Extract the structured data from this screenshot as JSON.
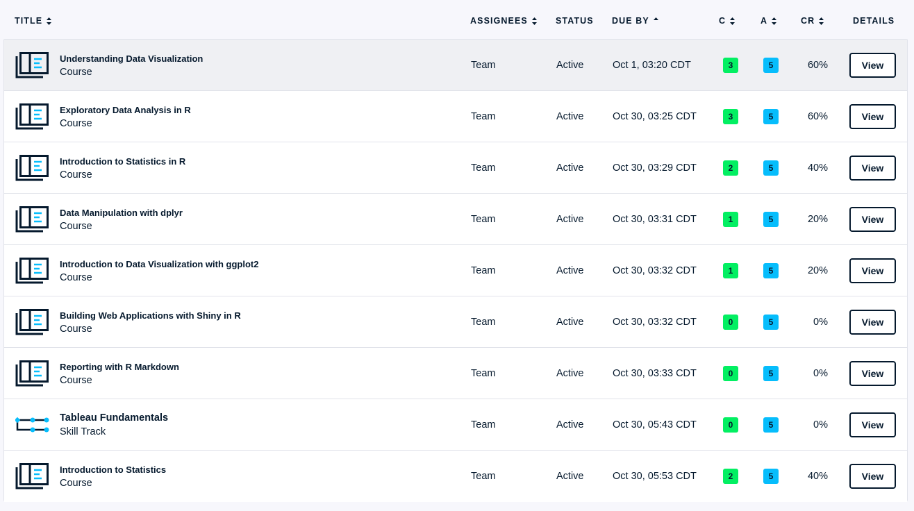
{
  "header": {
    "title": "TITLE",
    "assignees": "ASSIGNEES",
    "status": "STATUS",
    "due_by": "DUE BY",
    "c": "C",
    "a": "A",
    "cr": "CR",
    "details": "DETAILS"
  },
  "sort": {
    "active_column": "due_by",
    "direction": "ascending"
  },
  "colors": {
    "c_badge": "#03ef62",
    "a_badge": "#06bdfc",
    "row_highlight": "#eff0f3",
    "icon_accent": "#06bdfc",
    "ink": "#05192d"
  },
  "rows": [
    {
      "icon": "course-icon",
      "title": "Understanding Data Visualization",
      "type": "Course",
      "assignees": "Team",
      "status": "Active",
      "due": "Oct 1, 03:20 CDT",
      "c": "3",
      "a": "5",
      "cr": "60%",
      "action": "View"
    },
    {
      "icon": "course-icon",
      "title": "Exploratory Data Analysis in R",
      "type": "Course",
      "assignees": "Team",
      "status": "Active",
      "due": "Oct 30, 03:25 CDT",
      "c": "3",
      "a": "5",
      "cr": "60%",
      "action": "View"
    },
    {
      "icon": "course-icon",
      "title": "Introduction to Statistics in R",
      "type": "Course",
      "assignees": "Team",
      "status": "Active",
      "due": "Oct 30, 03:29 CDT",
      "c": "2",
      "a": "5",
      "cr": "40%",
      "action": "View"
    },
    {
      "icon": "course-icon",
      "title": "Data Manipulation with dplyr",
      "type": "Course",
      "assignees": "Team",
      "status": "Active",
      "due": "Oct 30, 03:31 CDT",
      "c": "1",
      "a": "5",
      "cr": "20%",
      "action": "View"
    },
    {
      "icon": "course-icon",
      "title": "Introduction to Data Visualization with ggplot2",
      "type": "Course",
      "assignees": "Team",
      "status": "Active",
      "due": "Oct 30, 03:32 CDT",
      "c": "1",
      "a": "5",
      "cr": "20%",
      "action": "View"
    },
    {
      "icon": "course-icon",
      "title": "Building Web Applications with Shiny in R",
      "type": "Course",
      "assignees": "Team",
      "status": "Active",
      "due": "Oct 30, 03:32 CDT",
      "c": "0",
      "a": "5",
      "cr": "0%",
      "action": "View"
    },
    {
      "icon": "course-icon",
      "title": "Reporting with R Markdown",
      "type": "Course",
      "assignees": "Team",
      "status": "Active",
      "due": "Oct 30, 03:33 CDT",
      "c": "0",
      "a": "5",
      "cr": "0%",
      "action": "View"
    },
    {
      "icon": "skill-track-icon",
      "title": "Tableau Fundamentals",
      "type": "Skill Track",
      "assignees": "Team",
      "status": "Active",
      "due": "Oct 30, 05:43 CDT",
      "c": "0",
      "a": "5",
      "cr": "0%",
      "action": "View"
    },
    {
      "icon": "course-icon",
      "title": "Introduction to Statistics",
      "type": "Course",
      "assignees": "Team",
      "status": "Active",
      "due": "Oct 30, 05:53 CDT",
      "c": "2",
      "a": "5",
      "cr": "40%",
      "action": "View"
    }
  ]
}
